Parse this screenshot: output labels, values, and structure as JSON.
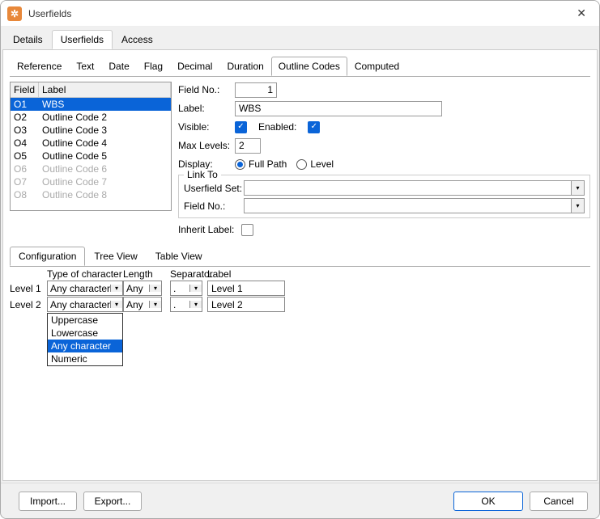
{
  "window": {
    "title": "Userfields"
  },
  "outer_tabs": [
    "Details",
    "Userfields",
    "Access"
  ],
  "outer_active": 1,
  "inner_tabs": [
    "Reference",
    "Text",
    "Date",
    "Flag",
    "Decimal",
    "Duration",
    "Outline Codes",
    "Computed"
  ],
  "inner_active": 6,
  "field_list": {
    "headers": {
      "field": "Field",
      "label": "Label"
    },
    "rows": [
      {
        "field": "O1",
        "label": "WBS",
        "selected": true,
        "enabled": true
      },
      {
        "field": "O2",
        "label": "Outline Code 2",
        "selected": false,
        "enabled": true
      },
      {
        "field": "O3",
        "label": "Outline Code 3",
        "selected": false,
        "enabled": true
      },
      {
        "field": "O4",
        "label": "Outline Code 4",
        "selected": false,
        "enabled": true
      },
      {
        "field": "O5",
        "label": "Outline Code 5",
        "selected": false,
        "enabled": true
      },
      {
        "field": "O6",
        "label": "Outline Code 6",
        "selected": false,
        "enabled": false
      },
      {
        "field": "O7",
        "label": "Outline Code 7",
        "selected": false,
        "enabled": false
      },
      {
        "field": "O8",
        "label": "Outline Code 8",
        "selected": false,
        "enabled": false
      }
    ]
  },
  "props": {
    "field_no_label": "Field No.:",
    "field_no_value": "1",
    "label_label": "Label:",
    "label_value": "WBS",
    "visible_label": "Visible:",
    "visible_checked": true,
    "enabled_label": "Enabled:",
    "enabled_checked": true,
    "max_levels_label": "Max Levels:",
    "max_levels_value": "2",
    "display_label": "Display:",
    "full_path_label": "Full Path",
    "level_label": "Level",
    "display_selected": "full_path"
  },
  "link_to": {
    "legend": "Link To",
    "userfield_set_label": "Userfield Set:",
    "userfield_set_value": "",
    "field_no_label": "Field No.:",
    "field_no_value": "",
    "inherit_label_label": "Inherit Label:",
    "inherit_checked": false
  },
  "conf_tabs": [
    "Configuration",
    "Tree View",
    "Table View"
  ],
  "conf_active": 0,
  "grid": {
    "headers": {
      "type": "Type of character",
      "length": "Length",
      "separator": "Separator",
      "label": "Label"
    },
    "rows": [
      {
        "level_name": "Level 1",
        "type": "Any character",
        "length": "Any",
        "separator": ".",
        "label": "Level 1"
      },
      {
        "level_name": "Level 2",
        "type": "Any character",
        "length": "Any",
        "separator": ".",
        "label": "Level 2"
      }
    ],
    "dropdown_options": [
      "Uppercase",
      "Lowercase",
      "Any character",
      "Numeric"
    ],
    "dropdown_selected": 2
  },
  "footer": {
    "import": "Import...",
    "export": "Export...",
    "ok": "OK",
    "cancel": "Cancel"
  }
}
